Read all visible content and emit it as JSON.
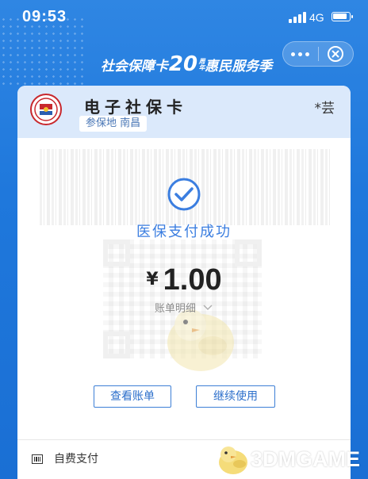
{
  "status_bar": {
    "time": "09:53",
    "network": "4G"
  },
  "banner": {
    "part1": "社会保障卡",
    "number": "20",
    "unit": "周年",
    "part2": "惠民服务季"
  },
  "card": {
    "title": "电子社保卡",
    "region_label": "参保地",
    "region_value": "南昌",
    "holder": "*芸"
  },
  "payment": {
    "status": "医保支付成功",
    "currency": "¥",
    "amount": "1.00",
    "detail_label": "账单明细"
  },
  "buttons": {
    "view_bill": "查看账单",
    "continue": "继续使用"
  },
  "footer": {
    "pay_method": "自费支付"
  },
  "watermark": {
    "text": "3DMGAME"
  },
  "colors": {
    "background": "#1f78dc",
    "accent": "#3b7ee0",
    "card_header": "#dbe9fb"
  },
  "icons": [
    "more-icon",
    "close-icon",
    "check-icon",
    "chevron-down-icon",
    "barcode-icon",
    "social-security-badge-icon"
  ]
}
